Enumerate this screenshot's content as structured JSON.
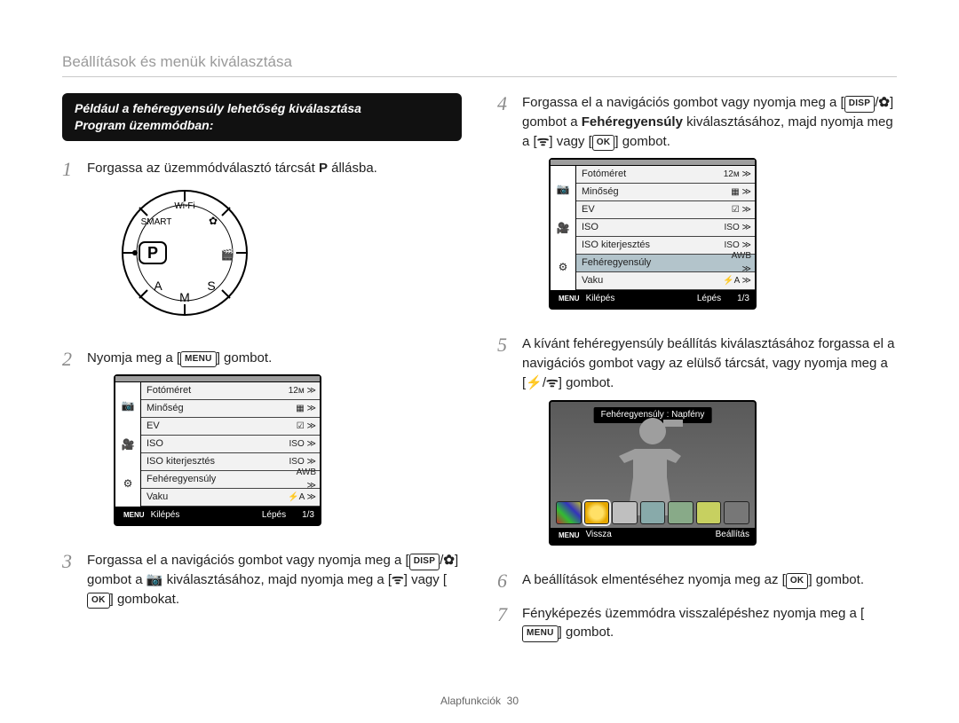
{
  "header": "Beállítások és menük kiválasztása",
  "black_banner_line1": "Például a fehéregyensúly lehetőség kiválasztása",
  "black_banner_line2": "Program üzemmódban:",
  "left": {
    "step1_a": "Forgassa az üzemmódválasztó tárcsát ",
    "step1_mode": "P",
    "step1_b": " állásba.",
    "step2_a": "Nyomja meg a [",
    "step2_menu": "MENU",
    "step2_b": "] gombot.",
    "step3_a": "Forgassa el a navigációs gombot vagy nyomja meg a [",
    "step3_disp": "DISP",
    "step3_b": "/",
    "step3_macro": "✿",
    "step3_c": "] gombot a ",
    "step3_cam": "📷",
    "step3_d": " kiválasztásához, majd nyomja meg a [",
    "step3_wifi": "ᯤ",
    "step3_e": "] vagy [",
    "step3_ok": "OK",
    "step3_f": "] gombokat."
  },
  "right": {
    "step4_a": "Forgassa el a navigációs gombot vagy nyomja meg a [",
    "step4_disp": "DISP",
    "step4_b": "/",
    "step4_macro": "✿",
    "step4_c": "] gombot a ",
    "step4_bold": "Fehéregyensúly",
    "step4_d": " kiválasztásához, majd nyomja meg a [",
    "step4_wifi": "ᯤ",
    "step4_e": "] vagy [",
    "step4_ok": "OK",
    "step4_f": "] gombot.",
    "step5_a": "A kívánt fehéregyensúly beállítás kiválasztásához forgassa el a navigációs gombot vagy az elülső tárcsát, vagy nyomja meg a [",
    "step5_flash": "⚡",
    "step5_b": "/",
    "step5_wifi": "ᯤ",
    "step5_c": "] gombot.",
    "step6_a": "A beállítások elmentéséhez nyomja meg az [",
    "step6_ok": "OK",
    "step6_b": "] gombot.",
    "step7_a": "Fényképezés üzemmódra visszalépéshez nyomja meg a [",
    "step7_menu": "MENU",
    "step7_b": "] gombot."
  },
  "menu_table": {
    "side": [
      "📷",
      "🎥",
      "⚙"
    ],
    "rows": [
      {
        "label": "Fotóméret",
        "right": "12м ≫"
      },
      {
        "label": "Minőség",
        "right": "▦ ≫"
      },
      {
        "label": "EV",
        "right": "☑ ≫"
      },
      {
        "label": "ISO",
        "right": "ISO ≫"
      },
      {
        "label": "ISO kiterjesztés",
        "right": "ISO ≫"
      },
      {
        "label": "Fehéregyensúly",
        "right": "AWB ≫"
      },
      {
        "label": "Vaku",
        "right": "⚡A ≫"
      }
    ],
    "footer_menu": "MENU",
    "footer_exit": "Kilépés",
    "footer_step": "Lépés",
    "footer_page": "1/3"
  },
  "wb_preview": {
    "banner": "Fehéregyensúly : Napfény",
    "footer_menu": "MENU",
    "footer_back": "Vissza",
    "footer_set": "Beállítás"
  },
  "footer_section": "Alapfunkciók",
  "footer_page": "30"
}
